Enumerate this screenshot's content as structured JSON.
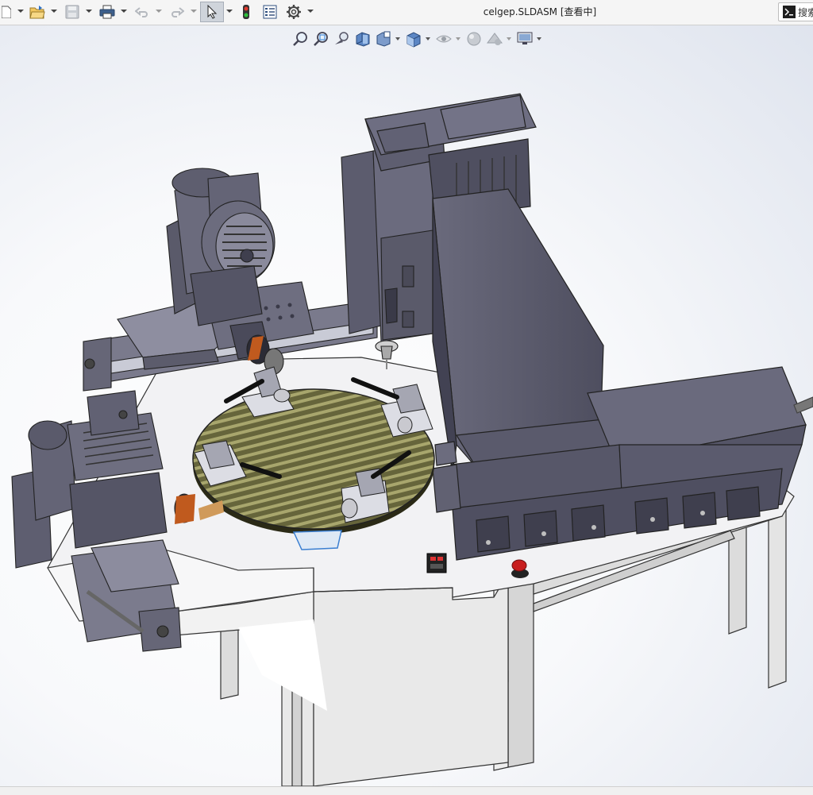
{
  "window": {
    "title": "celgep.SLDASM [查看中]"
  },
  "toolbar": {
    "items": [
      {
        "name": "new-document",
        "icon": "new-document-icon"
      },
      {
        "name": "open",
        "icon": "open-folder-icon"
      },
      {
        "name": "save",
        "icon": "save-icon"
      },
      {
        "name": "print",
        "icon": "printer-icon"
      },
      {
        "name": "undo",
        "icon": "undo-icon"
      },
      {
        "name": "redo",
        "icon": "redo-icon"
      },
      {
        "name": "select",
        "icon": "arrow-cursor-icon"
      },
      {
        "name": "rebuild",
        "icon": "traffic-light-icon"
      },
      {
        "name": "file-properties",
        "icon": "properties-icon"
      },
      {
        "name": "options",
        "icon": "gear-icon"
      }
    ]
  },
  "search": {
    "placeholder": "搜索"
  },
  "view_toolbar": {
    "items": [
      {
        "name": "zoom-to-fit",
        "icon": "magnifier-icon"
      },
      {
        "name": "zoom-to-area",
        "icon": "zoom-area-icon"
      },
      {
        "name": "previous-view",
        "icon": "previous-view-icon"
      },
      {
        "name": "section-view",
        "icon": "section-view-icon"
      },
      {
        "name": "dynamic-annotation",
        "icon": "annotation-cube-icon"
      },
      {
        "name": "view-orientation",
        "icon": "cube-orientation-icon"
      },
      {
        "name": "hide-show-items",
        "icon": "eye-icon"
      },
      {
        "name": "edit-appearance",
        "icon": "appearance-sphere-icon"
      },
      {
        "name": "apply-scene",
        "icon": "scene-icon"
      },
      {
        "name": "view-settings",
        "icon": "monitor-icon"
      }
    ]
  },
  "colors": {
    "machine_body": "#5d5d6e",
    "machine_dark": "#3f3f4e",
    "machine_light": "#7b7b8d",
    "table_frame": "#e6e6e6",
    "table_edge": "#9a9a9a",
    "rotary_table": "#6b6a3e",
    "rotary_slot": "#a6a56c",
    "estop": "#c81e1e"
  }
}
